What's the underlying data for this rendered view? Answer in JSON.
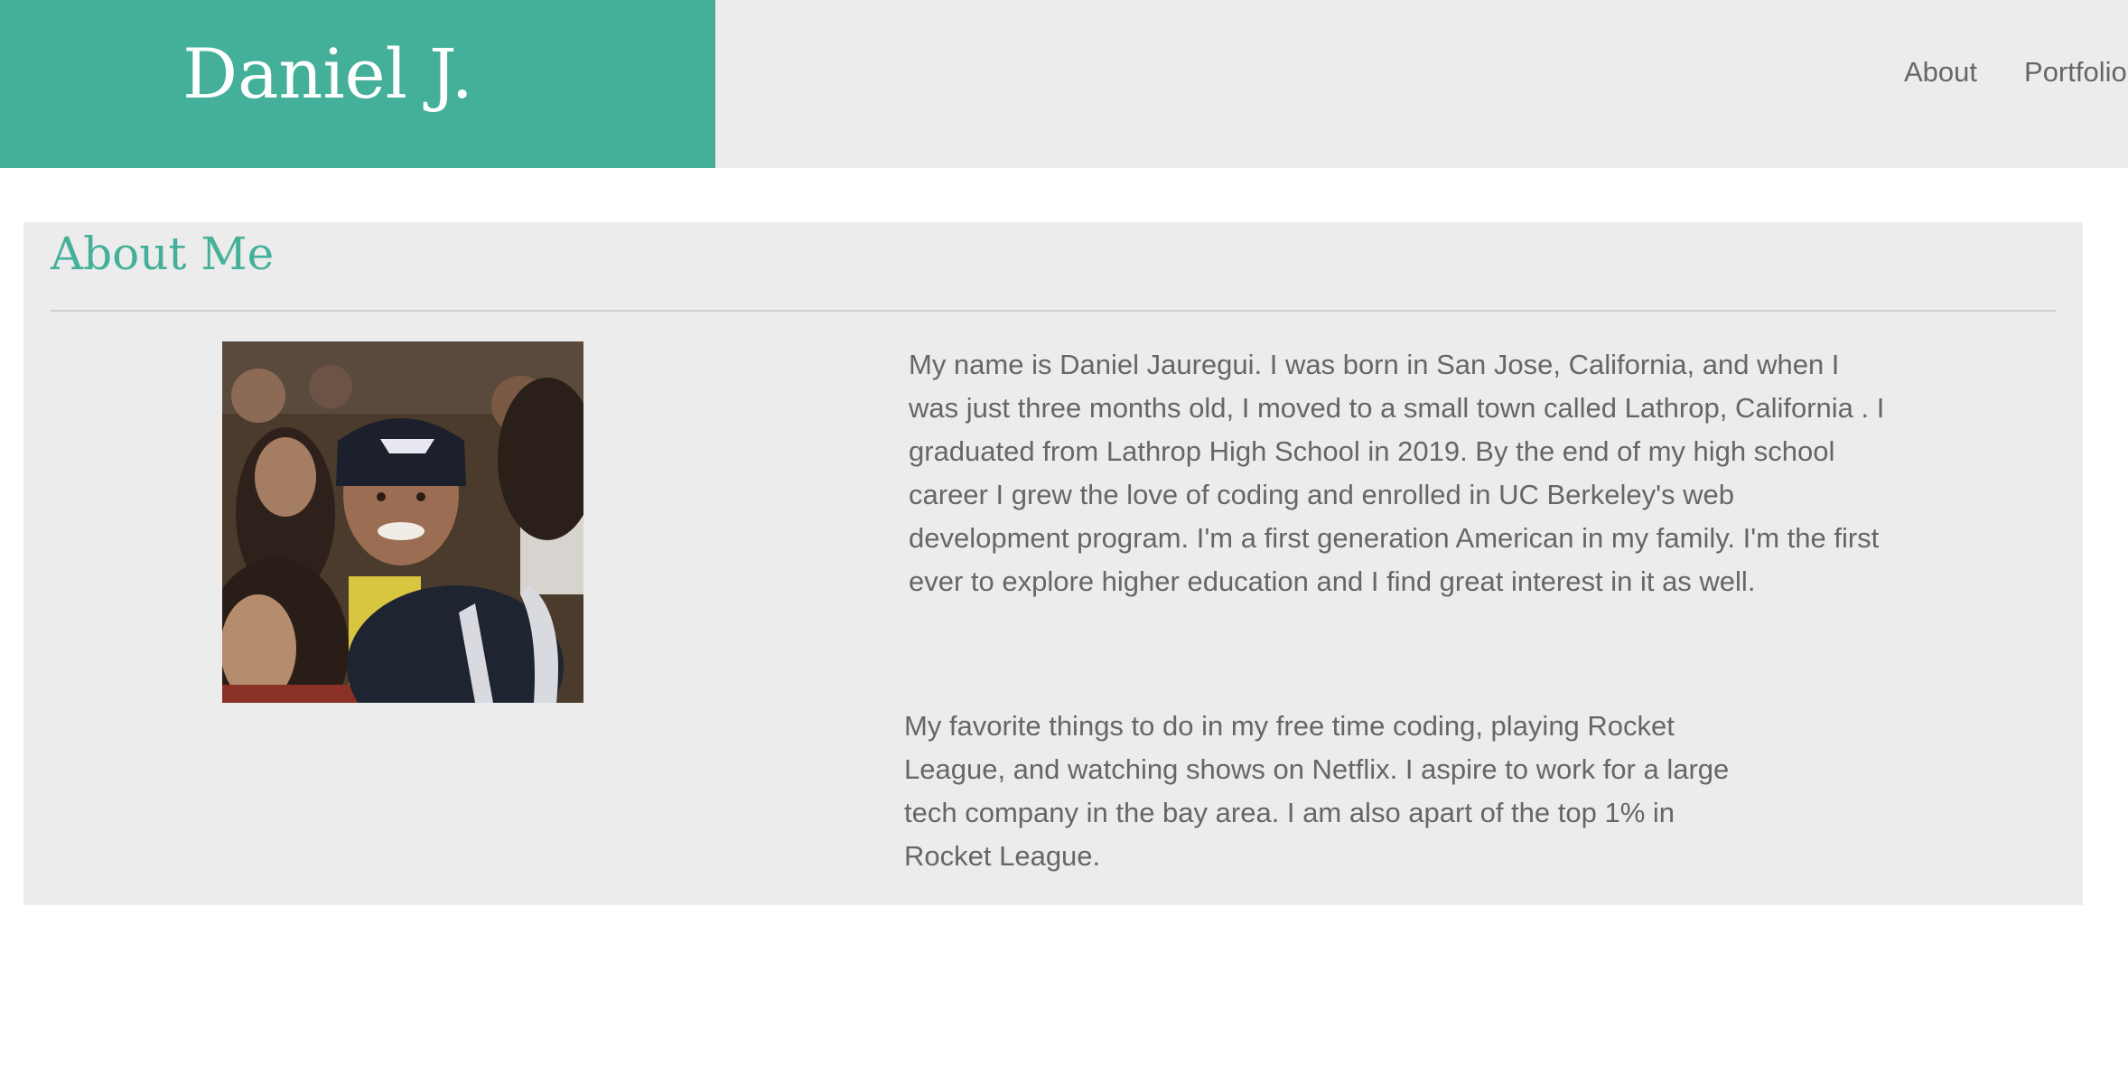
{
  "header": {
    "brand_name": "Daniel J.",
    "nav": [
      {
        "label": "About"
      },
      {
        "label": "Portfolio"
      }
    ]
  },
  "about": {
    "title": "About Me",
    "paragraph_1": "My name is Daniel Jauregui. I was born in San Jose, California, and when I was just three months old, I moved to a small town called Lathrop, California . I graduated from Lathrop High School in 2019. By the end of my high school career I grew the love of coding and enrolled in UC Berkeley's web development program. I'm a first generation American in my family. I'm the first ever to explore higher education and I find great interest in it as well.",
    "paragraph_2": "My favorite things to do in my free time coding, playing Rocket League, and watching shows on Netflix. I aspire to work for a large tech company in the bay area. I am also apart of the top 1% in Rocket League."
  },
  "colors": {
    "accent": "#45b09a",
    "panel_background": "#ececec",
    "text": "#666666"
  }
}
